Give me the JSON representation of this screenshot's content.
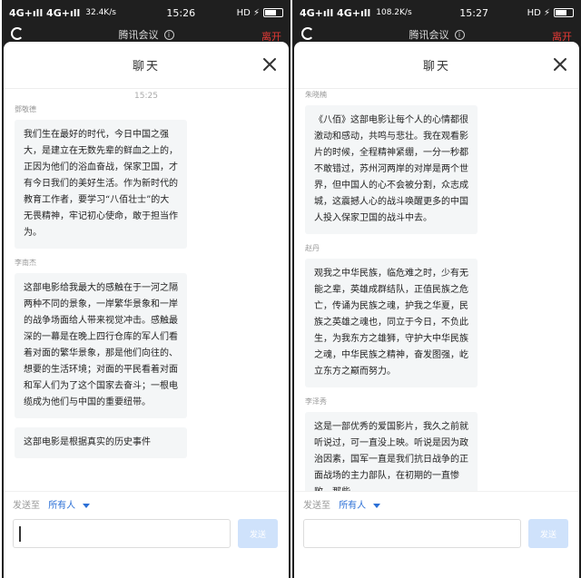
{
  "left": {
    "status": {
      "signal": "4G+ıll 4G+ıll",
      "speed": "32.4K/s",
      "time": "15:26",
      "icons": "HD ⚡"
    },
    "appbar": {
      "title": "腾讯会议",
      "leave": "离开"
    },
    "sheet_title": "聊天",
    "timestamp": "15:25",
    "messages": [
      {
        "sender": "鄧敬德",
        "text": "我们生在最好的时代，今日中国之强大，是建立在无数先辈的鲜血之上的，正因为他们的浴血奋战，保家卫国，才有今日我们的美好生活。作为新时代的教育工作者，要学习“八佰壮士”的大无畏精神，牢记初心使命，敢于担当作为。"
      },
      {
        "sender": "李南杰",
        "text": "这部电影给我最大的感触在于一河之隔两种不同的景象，一岸繁华景象和一岸的战争场面给人带来视觉冲击。感触最深的一幕是在晚上四行仓库的军人们看着对面的繁华景象，那是他们向往的、想要的生活环境；对面的平民看着对面和军人们为了这个国家去奋斗；一根电缆成为他们与中国的重要纽带。"
      },
      {
        "sender": "",
        "text": "这部电影是根据真实的历史事件"
      }
    ],
    "composer": {
      "send_to_label": "发送至",
      "send_to_target": "所有人",
      "input_placeholder": "",
      "send_label": "发送"
    }
  },
  "right": {
    "status": {
      "signal": "4G+ıll 4G+ıll",
      "speed": "108.2K/s",
      "time": "15:27",
      "icons": "HD ⚡"
    },
    "appbar": {
      "title": "腾讯会议",
      "leave": "离开"
    },
    "sheet_title": "聊天",
    "messages": [
      {
        "sender": "朱晓楠",
        "text": "《八佰》这部电影让每个人的心情都很激动和感动，共鸣与悲壮。我在观看影片的时候，全程精神紧绷，一分一秒都不敢错过，苏州河两岸的对岸是两个世界，但中国人的心不会被分割，众志成城，这震撼人心的战斗唤醒更多的中国人投入保家卫国的战斗中去。"
      },
      {
        "sender": "赵丹",
        "text": "观我之中华民族，临危难之时，少有无能之辈，英雄成群结队，正值民族之危亡，传诵为民族之魂，护我之华夏，民族之英雄之魂也，同立于今日，不负此生，为我东方之雄狮，守护大中华民族之魂，中华民族之精神，奋发图强，屹立东方之巅而努力。"
      },
      {
        "sender": "李泽秀",
        "text": "这是一部优秀的爱国影片，我久之前就听说过，可一直没上映。听说是因为政治因素，国军一直是我们抗日战争的正面战场的主力部队，在初期的一直惨败，那些"
      }
    ],
    "composer": {
      "send_to_label": "发送至",
      "send_to_target": "所有人",
      "input_placeholder": "",
      "send_label": "发送"
    }
  }
}
